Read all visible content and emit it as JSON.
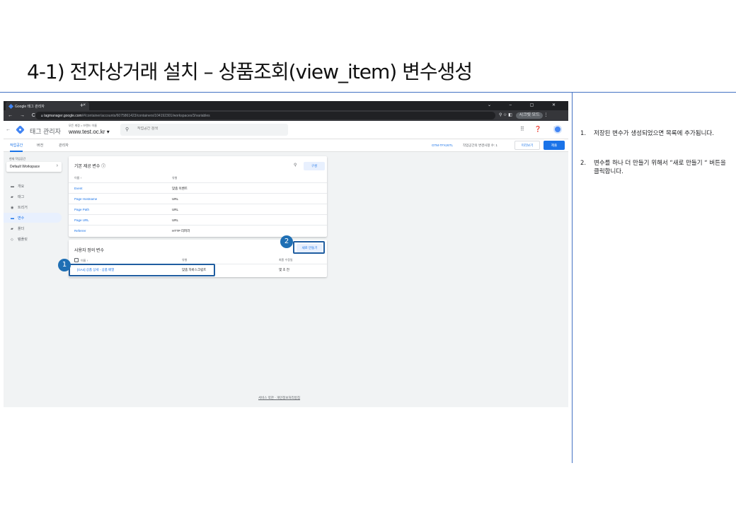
{
  "slide": {
    "title": "4-1) 전자상거래 설치 – 상품조회(view_item)  변수생성"
  },
  "browser": {
    "tab_title": "Google 태그 관리자",
    "tab_close": "×",
    "new_tab": "+",
    "window_controls": "⌄ – ▢ ✕",
    "nav_buttons": "← → C",
    "url_host": "tagmanager.google.com",
    "url_path": "/#/container/accounts/6075861423/containers/104192301/workspaces/3/variables",
    "addr_icons": "⚲ ☆ ◧",
    "profile_label": "시크릿 모드",
    "menu_dots": "⋮"
  },
  "gtm": {
    "app_name": "태그 관리자",
    "account_crumb": "모든 계정 > 브랜드 이름",
    "container_name": "www.test.oc.kr ▾",
    "search_placeholder": "작업공간 검색",
    "header_icons": "⠿ ❓ ⋮",
    "subnav": {
      "workspace": "작업공간",
      "versions": "버전",
      "admin": "관리자"
    },
    "container_id": "GTM-TFXJ6TL",
    "changes_text": "작업공간의 변경사항 수: 1",
    "preview_label": "미리보기",
    "submit_label": "제출"
  },
  "sidebar": {
    "ws_label": "현재 작업공간",
    "workspace": "Default Workspace",
    "items": [
      {
        "icon": "▬",
        "label": "개요"
      },
      {
        "icon": "▰",
        "label": "태그"
      },
      {
        "icon": "◉",
        "label": "트리거"
      },
      {
        "icon": "▬",
        "label": "변수"
      },
      {
        "icon": "▰",
        "label": "폴더"
      },
      {
        "icon": "◇",
        "label": "템플릿"
      }
    ]
  },
  "builtin": {
    "title": "기본 제공 변수 ⓘ",
    "config_label": "구성",
    "col_name": "이름 ↑",
    "col_type": "유형",
    "rows": [
      {
        "name": "Event",
        "type": "맞춤 이벤트"
      },
      {
        "name": "Page Hostname",
        "type": "URL"
      },
      {
        "name": "Page Path",
        "type": "URL"
      },
      {
        "name": "Page URL",
        "type": "URL"
      },
      {
        "name": "Referrer",
        "type": "HTTP 리퍼러"
      }
    ]
  },
  "user_defined": {
    "title": "사용자 정의 변수",
    "new_label": "새로 만들기",
    "col_name": "이름 ↑",
    "col_type": "유형",
    "col_modified": "최종 수정일",
    "rows": [
      {
        "name": "[GA4] 상품 상세 - 상품 배열",
        "type": "맞춤 자바스크립트",
        "modified": "몇 초 전"
      }
    ]
  },
  "markers": {
    "one": "1",
    "two": "2"
  },
  "footer": {
    "links": "서비스 약관 · 개인정보처리방침"
  },
  "notes": [
    {
      "num": "1.",
      "text": "저장된 변수가 생성되었으면 목록에 추가됨니다."
    },
    {
      "num": "2.",
      "text": "변수를 하나 더 만들기 위해서 “새로 만들기 “ 버튼을 클릭합니다."
    }
  ],
  "colors": {
    "accent": "#1a73e8",
    "marker": "#1f6fb4",
    "divider": "#4472c4"
  }
}
